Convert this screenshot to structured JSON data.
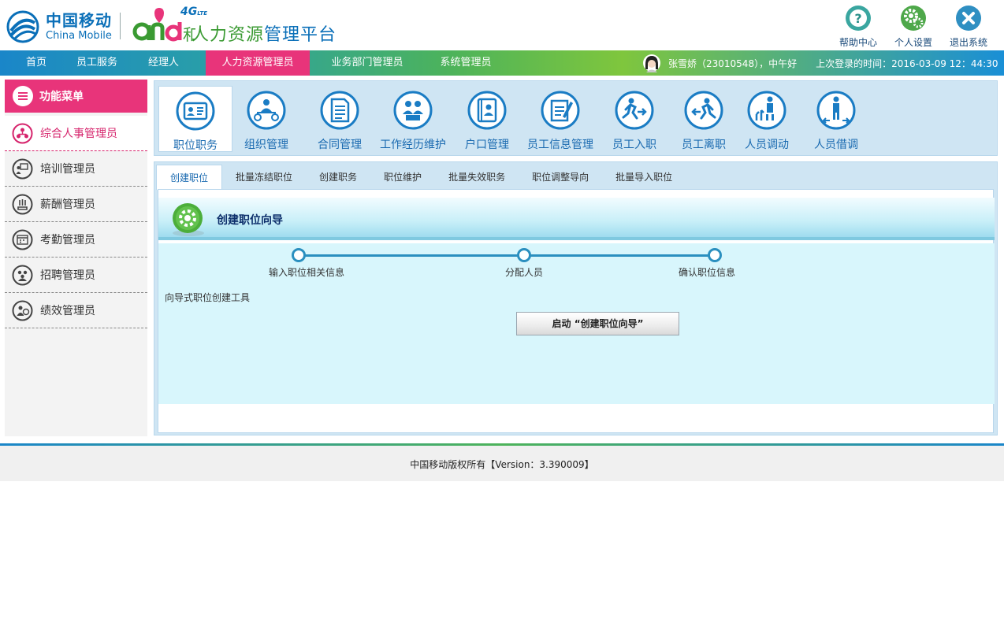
{
  "brand": {
    "cn_name": "中国移动",
    "en_name": "China Mobile",
    "network_badge": "4G",
    "network_badge_sub": "LTE",
    "platform_title_prefix": "人力资源",
    "platform_title_suffix": "管理平台",
    "colors": {
      "primary_blue": "#0a6fb8",
      "brand_green": "#3a9a32",
      "accent_pink": "#e8347a"
    }
  },
  "top_tools": [
    {
      "label": "帮助中心",
      "icon": "help-icon"
    },
    {
      "label": "个人设置",
      "icon": "settings-icon"
    },
    {
      "label": "退出系统",
      "icon": "logout-icon"
    }
  ],
  "nav": {
    "items": [
      {
        "label": "首页",
        "active": false
      },
      {
        "label": "员工服务",
        "active": false
      },
      {
        "label": "经理人",
        "active": false
      },
      {
        "label": "人力资源管理员",
        "active": true
      },
      {
        "label": "业务部门管理员",
        "active": false
      },
      {
        "label": "系统管理员",
        "active": false
      }
    ],
    "user_greeting": "张雪娇（23010548），中午好",
    "last_login": "上次登录的时间：2016-03-09  12：44:30"
  },
  "sidebar": {
    "title": "功能菜单",
    "items": [
      {
        "label": "综合人事管理员",
        "active": true
      },
      {
        "label": "培训管理员",
        "active": false
      },
      {
        "label": "薪酬管理员",
        "active": false
      },
      {
        "label": "考勤管理员",
        "active": false
      },
      {
        "label": "招聘管理员",
        "active": false
      },
      {
        "label": "绩效管理员",
        "active": false
      }
    ]
  },
  "functions": [
    {
      "label": "职位职务",
      "icon": "position-card-icon",
      "active": true
    },
    {
      "label": "组织管理",
      "icon": "org-tree-icon",
      "active": false
    },
    {
      "label": "合同管理",
      "icon": "contract-icon",
      "active": false
    },
    {
      "label": "工作经历维护",
      "icon": "work-history-icon",
      "active": false
    },
    {
      "label": "户口管理",
      "icon": "household-register-icon",
      "active": false
    },
    {
      "label": "员工信息管理",
      "icon": "employee-info-icon",
      "active": false
    },
    {
      "label": "员工入职",
      "icon": "onboarding-icon",
      "active": false
    },
    {
      "label": "员工离职",
      "icon": "offboarding-icon",
      "active": false
    },
    {
      "label": "人员调动",
      "icon": "transfer-icon",
      "active": false
    },
    {
      "label": "人员借调",
      "icon": "secondment-icon",
      "active": false
    }
  ],
  "tabs": [
    {
      "label": "创建职位",
      "active": true
    },
    {
      "label": "批量冻结职位",
      "active": false
    },
    {
      "label": "创建职务",
      "active": false
    },
    {
      "label": "职位维护",
      "active": false
    },
    {
      "label": "批量失效职务",
      "active": false
    },
    {
      "label": "职位调整导向",
      "active": false
    },
    {
      "label": "批量导入职位",
      "active": false
    }
  ],
  "wizard": {
    "title": "创建职位向导",
    "steps": [
      "输入职位相关信息",
      "分配人员",
      "确认职位信息"
    ],
    "description": "向导式职位创建工具",
    "start_button": "启动 “创建职位向导”"
  },
  "footer": {
    "copyright": "中国移动版权所有【Version：3.390009】"
  }
}
